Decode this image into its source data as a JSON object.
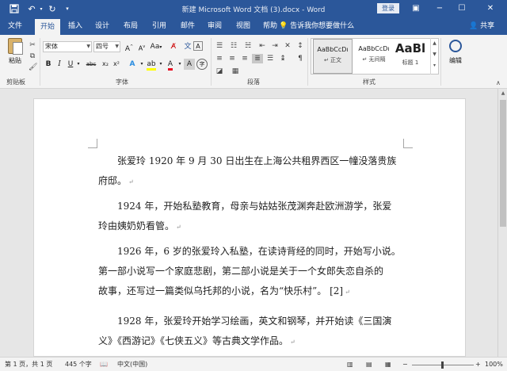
{
  "titlebar": {
    "title": "新建 Microsoft Word 文档 (3).docx - Word",
    "login_label": "登录",
    "save_icon": "save-icon",
    "undo_icon": "undo-icon",
    "redo_icon": "redo-icon",
    "customize_icon": "customize-qat-icon"
  },
  "tabs": [
    "文件",
    "开始",
    "插入",
    "设计",
    "布局",
    "引用",
    "邮件",
    "审阅",
    "视图",
    "帮助"
  ],
  "tell_me": "告诉我你想要做什么",
  "share": "共享",
  "ribbon": {
    "clipboard": {
      "paste_label": "粘贴",
      "group_label": "剪贴板"
    },
    "font": {
      "font_name": "宋体",
      "font_size": "四号",
      "group_label": "字体",
      "grow_label": "A",
      "case_label": "Aa",
      "bold": "B",
      "italic": "I",
      "underline": "U",
      "strike": "abc",
      "subscript": "x₂",
      "superscript": "x²"
    },
    "paragraph": {
      "group_label": "段落"
    },
    "styles": {
      "group_label": "样式",
      "items": [
        {
          "preview": "AaBbCcDı",
          "name": "↵ 正文"
        },
        {
          "preview": "AaBbCcDı",
          "name": "↵ 无间隔"
        },
        {
          "preview": "AaBl",
          "name": "标题 1"
        }
      ]
    },
    "editing": {
      "label": "编辑"
    }
  },
  "document": {
    "paragraphs": [
      [
        "张爱玲 1920 年 9 月 30 日出生在上海公共租界西区一幢没落贵族",
        "府邸。"
      ],
      [
        "1924 年，开始私塾教育，母亲与姑姑张茂渊奔赴欧洲游学，张爱",
        "玲由姨奶奶看管。"
      ],
      [
        "1926 年，6 岁的张爱玲入私塾，在读诗背经的同时，开始写小说。",
        "第一部小说写一个家庭悲剧，第二部小说是关于一个女郎失恋自杀的",
        "故事，还写过一篇类似乌托邦的小说，名为“快乐村”。 [2]"
      ],
      [
        "1928 年，张爱玲开始学习绘画，英文和钢琴，并开始读《三国演",
        "义》《西游记》《七侠五义》等古典文学作品。"
      ]
    ]
  },
  "statusbar": {
    "page": "第 1 页，共 1 页",
    "words": "445 个字",
    "language": "中文(中国)",
    "zoom": "100%",
    "zoom_minus": "−",
    "zoom_plus": "+"
  }
}
